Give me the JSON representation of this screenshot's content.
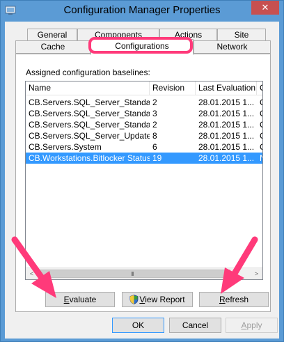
{
  "window": {
    "title": "Configuration Manager Properties",
    "close_glyph": "✕"
  },
  "tabs": {
    "row1": [
      {
        "label": "General"
      },
      {
        "label": "Components"
      },
      {
        "label": "Actions"
      },
      {
        "label": "Site"
      }
    ],
    "row2": [
      {
        "label": "Cache"
      },
      {
        "label": "Configurations",
        "active": true
      },
      {
        "label": "Network"
      }
    ]
  },
  "panel": {
    "label": "Assigned configuration baselines:",
    "columns": [
      "Name",
      "Revision",
      "Last Evaluation",
      "C"
    ],
    "rows": [
      {
        "name": "CB.Servers.SQL_Server_Standar...",
        "revision": "2",
        "last_eval": "28.01.2015 1...",
        "c": "C"
      },
      {
        "name": "CB.Servers.SQL_Server_Standar...",
        "revision": "3",
        "last_eval": "28.01.2015 1...",
        "c": "C"
      },
      {
        "name": "CB.Servers.SQL_Server_Standar...",
        "revision": "2",
        "last_eval": "28.01.2015 1...",
        "c": "C"
      },
      {
        "name": "CB.Servers.SQL_Server_Update....",
        "revision": "8",
        "last_eval": "28.01.2015 1...",
        "c": "C"
      },
      {
        "name": "CB.Servers.System",
        "revision": "6",
        "last_eval": "28.01.2015 1...",
        "c": "C"
      },
      {
        "name": "CB.Workstations.Bitlocker Status",
        "revision": "19",
        "last_eval": "28.01.2015 1...",
        "c": "N",
        "selected": true
      }
    ],
    "scroll_left": "<",
    "scroll_right": ">",
    "scroll_grip": "III"
  },
  "panel_buttons": {
    "evaluate_ul": "E",
    "evaluate_rest": "valuate",
    "view_report_ul": "V",
    "view_report_rest": "iew Report",
    "refresh_ul": "R",
    "refresh_rest": "efresh"
  },
  "dialog_buttons": {
    "ok": "OK",
    "cancel": "Cancel",
    "apply_ul": "A",
    "apply_rest": "pply"
  },
  "colors": {
    "title_bar": "#5b9bd5",
    "selection": "#3399ff",
    "annotation": "#ff3a7a",
    "close_button": "#c75050"
  }
}
